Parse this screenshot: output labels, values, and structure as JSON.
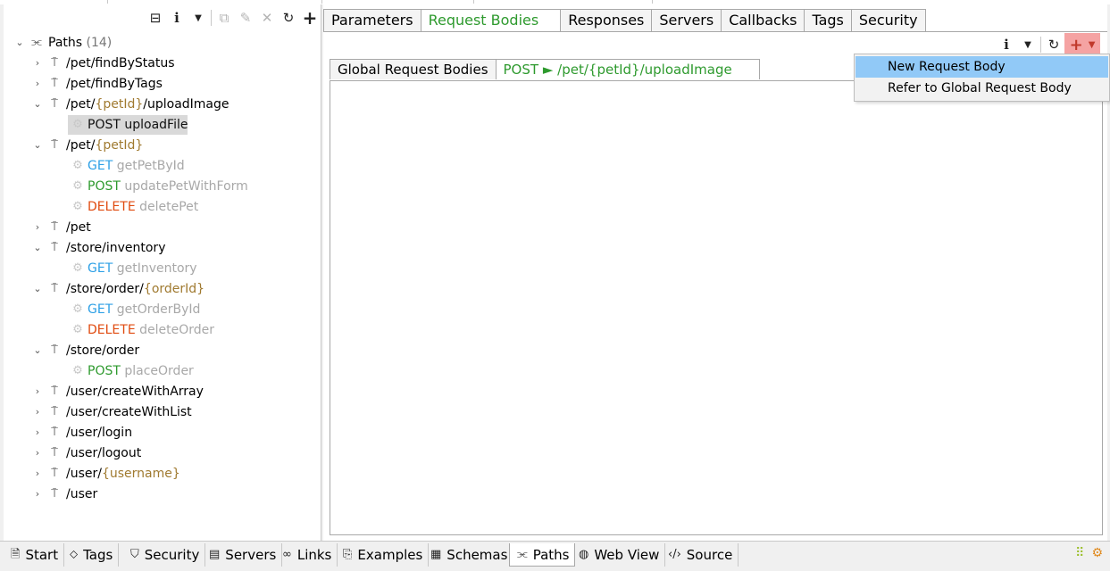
{
  "left_toolbar": {
    "icons": [
      "collapse-icon",
      "info-icon",
      "chevron-down-icon",
      "copy-icon",
      "edit-icon",
      "close-icon",
      "refresh-icon",
      "plus-icon"
    ]
  },
  "tree": {
    "root": {
      "label": "Paths",
      "count": "(14)"
    },
    "paths": [
      {
        "label": "/pet/findByStatus",
        "expanded": false
      },
      {
        "label": "/pet/findByTags",
        "expanded": false
      },
      {
        "label_pre": "/pet/",
        "label_param": "{petId}",
        "label_post": "/uploadImage",
        "expanded": true
      },
      {
        "op_verb": "POST",
        "op_name": "uploadFile",
        "selected": true
      },
      {
        "label_pre": "/pet/",
        "label_param": "{petId}",
        "expanded": true
      },
      {
        "op_verb": "GET",
        "op_name": "getPetById"
      },
      {
        "op_verb": "POST",
        "op_name": "updatePetWithForm"
      },
      {
        "op_verb": "DELETE",
        "op_name": "deletePet"
      },
      {
        "label": "/pet",
        "expanded": false
      },
      {
        "label": "/store/inventory",
        "expanded": true
      },
      {
        "op_verb": "GET",
        "op_name": "getInventory"
      },
      {
        "label_pre": "/store/order/",
        "label_param": "{orderId}",
        "expanded": true
      },
      {
        "op_verb": "GET",
        "op_name": "getOrderById"
      },
      {
        "op_verb": "DELETE",
        "op_name": "deleteOrder"
      },
      {
        "label": "/store/order",
        "expanded": true
      },
      {
        "op_verb": "POST",
        "op_name": "placeOrder"
      },
      {
        "label": "/user/createWithArray",
        "expanded": false
      },
      {
        "label": "/user/createWithList",
        "expanded": false
      },
      {
        "label": "/user/login",
        "expanded": false
      },
      {
        "label": "/user/logout",
        "expanded": false
      },
      {
        "label_pre": "/user/",
        "label_param": "{username}",
        "expanded": false
      },
      {
        "label": "/user",
        "expanded": false
      }
    ]
  },
  "main_tabs": [
    "Parameters",
    "Request Bodies",
    "Responses",
    "Servers",
    "Callbacks",
    "Tags",
    "Security"
  ],
  "active_main_tab": "Request Bodies",
  "sub_tabs": {
    "global": "Global Request Bodies",
    "operation_verb": "POST",
    "operation_arrow": "►",
    "operation_path": "/pet/{petId}/uploadImage"
  },
  "dropdown_menu": {
    "items": [
      "New Request Body",
      "Refer to Global Request Body"
    ],
    "hovered": "New Request Body"
  },
  "bottom_tabs": [
    {
      "label": "Start",
      "icon": "document-icon"
    },
    {
      "label": "Tags",
      "icon": "tag-icon"
    },
    {
      "label": "Security",
      "icon": "shield-icon"
    },
    {
      "label": "Servers",
      "icon": "server-icon"
    },
    {
      "label": "Links",
      "icon": "link-icon"
    },
    {
      "label": "Examples",
      "icon": "examples-icon"
    },
    {
      "label": "Schemas",
      "icon": "schemas-icon"
    },
    {
      "label": "Paths",
      "icon": "paths-icon",
      "active": true
    },
    {
      "label": "Web View",
      "icon": "globe-icon"
    },
    {
      "label": "Source",
      "icon": "code-icon"
    }
  ],
  "colors": {
    "get": "#2da0e6",
    "post": "#2e9a2e",
    "delete": "#e04b10",
    "param": "#a07a30",
    "menu_hover": "#91c9f7",
    "plus_button_bg": "#f5a3a3"
  }
}
